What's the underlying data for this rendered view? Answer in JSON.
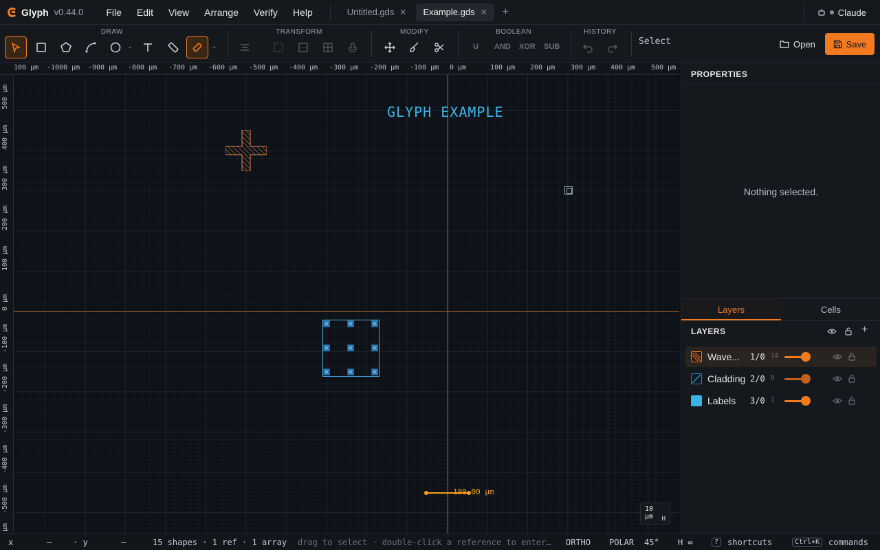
{
  "app": {
    "name": "Glyph",
    "version": "v0.44.0",
    "user": "Claude"
  },
  "menu": [
    "File",
    "Edit",
    "View",
    "Arrange",
    "Verify",
    "Help"
  ],
  "tabs": [
    {
      "label": "Untitled.gds",
      "active": false
    },
    {
      "label": "Example.gds",
      "active": true
    }
  ],
  "toolbar": {
    "groups": [
      "DRAW",
      "TRANSFORM",
      "MODIFY",
      "BOOLEAN",
      "HISTORY"
    ],
    "boolean_ops": [
      "U",
      "AND",
      "XOR",
      "SUB"
    ],
    "mode": "Select",
    "open_label": "Open",
    "save_label": "Save",
    "accent": "#f47a20"
  },
  "ruler": {
    "top": [
      "100 µm",
      "-1000 µm",
      "-900 µm",
      "-800 µm",
      "-700 µm",
      "-600 µm",
      "-500 µm",
      "-400 µm",
      "-300 µm",
      "-200 µm",
      "-100 µm",
      "0 µm",
      "100 µm",
      "200 µm",
      "300 µm",
      "400 µm",
      "500 µm"
    ],
    "left": [
      "500 µm",
      "400 µm",
      "300 µm",
      "200 µm",
      "100 µm",
      "0 µm",
      "-100 µm",
      "-200 µm",
      "-300 µm",
      "-400 µm",
      "-500 µm",
      "µm"
    ]
  },
  "canvas": {
    "title_text": "GLYPH EXAMPLE",
    "scalebar_label": "100.00 µm",
    "zoom_label": "10 µm",
    "zoom_sub": "H"
  },
  "panel": {
    "properties_title": "PROPERTIES",
    "empty_text": "Nothing selected.",
    "tabs": [
      "Layers",
      "Cells"
    ],
    "layers_title": "LAYERS",
    "layers": [
      {
        "name": "Wave...",
        "num": "1/0",
        "count": "14",
        "color": "#f47a20",
        "selected": true
      },
      {
        "name": "Cladding",
        "num": "2/0",
        "count": "0",
        "color": "#2a7fb8",
        "selected": false
      },
      {
        "name": "Labels",
        "num": "3/0",
        "count": "1",
        "color": "#39b4e6",
        "selected": false
      }
    ]
  },
  "status": {
    "x_label": "x",
    "x_val": "—",
    "y_label": "· y",
    "y_val": "—",
    "shapes": "15 shapes · 1 ref · 1 array",
    "hint": "drag to select · double-click a reference to enter…",
    "ortho": "ORTHO",
    "polar": "POLAR",
    "angle": "45°",
    "h": "H ∞",
    "shortcuts_key": "?",
    "shortcuts": "shortcuts",
    "commands_key": "Ctrl+K",
    "commands": "commands"
  }
}
